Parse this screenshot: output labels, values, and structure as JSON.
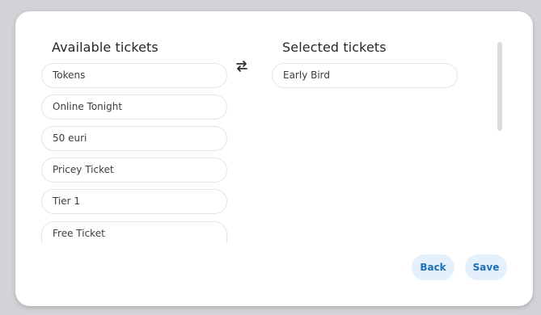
{
  "dialog": {
    "available_title": "Available tickets",
    "selected_title": "Selected tickets",
    "available": [
      "Tokens",
      "Online Tonight",
      "50 euri",
      "Pricey Ticket",
      "Tier 1",
      "Free Ticket"
    ],
    "selected": [
      "Early Bird"
    ],
    "back_label": "Back",
    "save_label": "Save",
    "icons": {
      "transfer": "swap-arrows-icon"
    }
  },
  "colors": {
    "backdrop": "#d1d3d6",
    "button_bg": "#e4f0fb",
    "button_text": "#1f6fb7"
  }
}
